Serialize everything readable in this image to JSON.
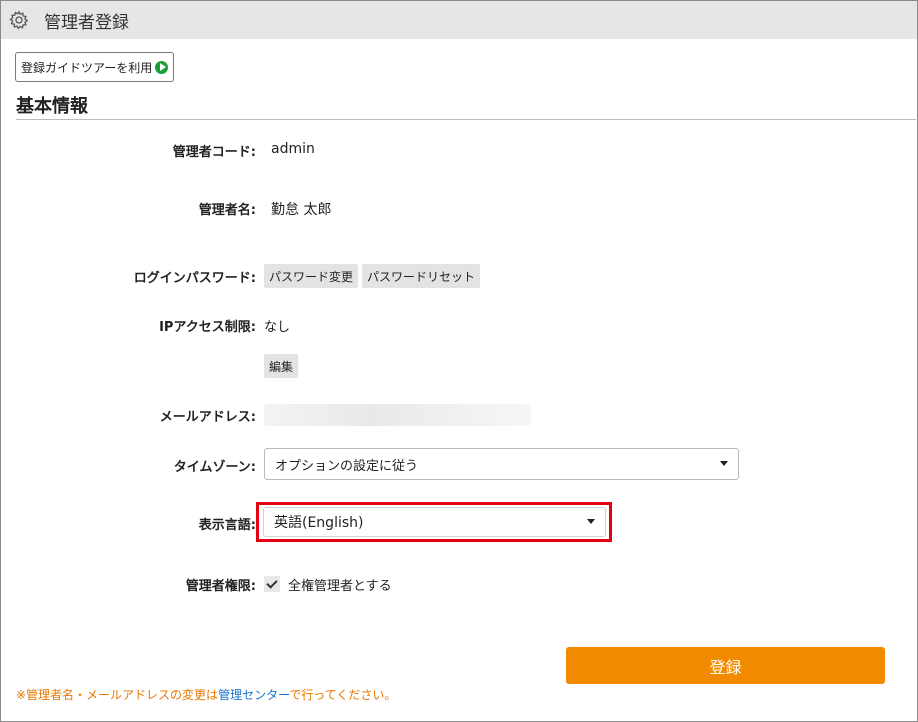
{
  "window": {
    "title": "管理者登録",
    "icon": "gear-icon"
  },
  "guide_button": {
    "label": "登録ガイドツアーを利用",
    "icon": "play-icon",
    "icon_color": "#1a9e3a"
  },
  "section": {
    "title": "基本情報"
  },
  "form": {
    "admin_code": {
      "label": "管理者コード:",
      "value": "admin"
    },
    "admin_name": {
      "label": "管理者名:",
      "value": "勤怠 太郎"
    },
    "login_password": {
      "label": "ログインパスワード:",
      "change_button": "パスワード変更",
      "reset_button": "パスワードリセット"
    },
    "ip_access": {
      "label": "IPアクセス制限:",
      "value": "なし",
      "edit_button": "編集"
    },
    "email": {
      "label": "メールアドレス:"
    },
    "timezone": {
      "label": "タイムゾーン:",
      "selected": "オプションの設定に従う"
    },
    "language": {
      "label": "表示言語:",
      "selected": "英語(English)",
      "highlight_color": "#e60012"
    },
    "admin_role": {
      "label": "管理者権限:",
      "checkbox_label": "全権管理者とする",
      "checked": true
    }
  },
  "submit": {
    "label": "登録",
    "color": "#f28a00"
  },
  "footnote": {
    "prefix": "※管理者名・メールアドレスの変更は",
    "link": "管理センター",
    "suffix": "で行ってください。"
  }
}
